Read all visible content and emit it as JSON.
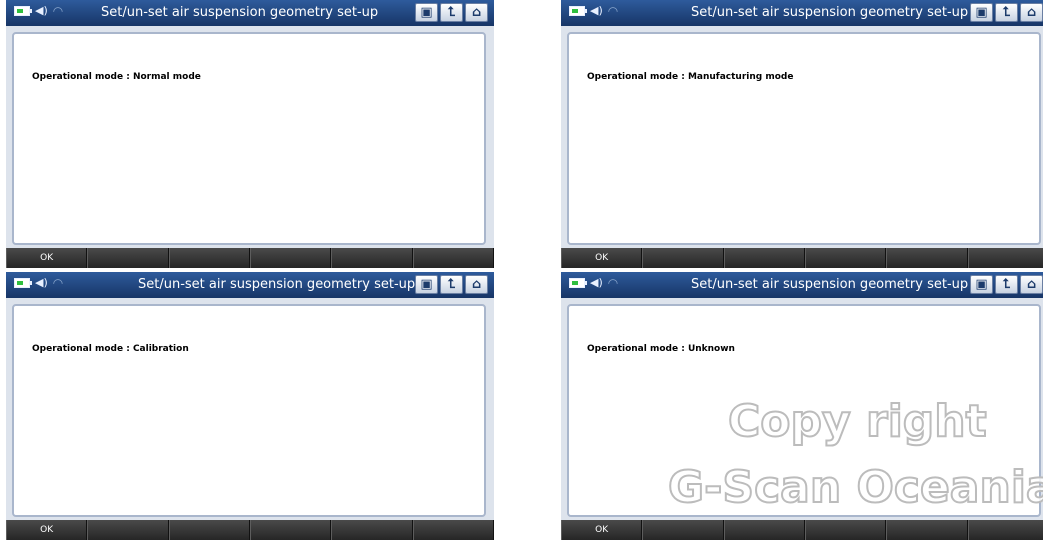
{
  "screens": [
    {
      "title": "Set/un-set air suspension geometry set-up",
      "mode_text": "Operational mode : Normal mode",
      "ok_label": "OK"
    },
    {
      "title": "Set/un-set air suspension geometry set-up",
      "mode_text": "Operational mode : Manufacturing mode",
      "ok_label": "OK"
    },
    {
      "title": "Set/un-set air suspension geometry set-up",
      "mode_text": "Operational mode : Calibration",
      "ok_label": "OK"
    },
    {
      "title": "Set/un-set air suspension geometry set-up",
      "mode_text": "Operational mode : Unknown",
      "ok_label": "OK"
    }
  ],
  "icons": {
    "battery": "battery-icon",
    "speaker": "speaker-icon",
    "signal": "signal-icon",
    "screenshot": "screen-capture-icon",
    "back": "back-icon",
    "home": "home-icon"
  },
  "watermark": {
    "line1": "Copy right",
    "line2": "G-Scan Oceania"
  }
}
